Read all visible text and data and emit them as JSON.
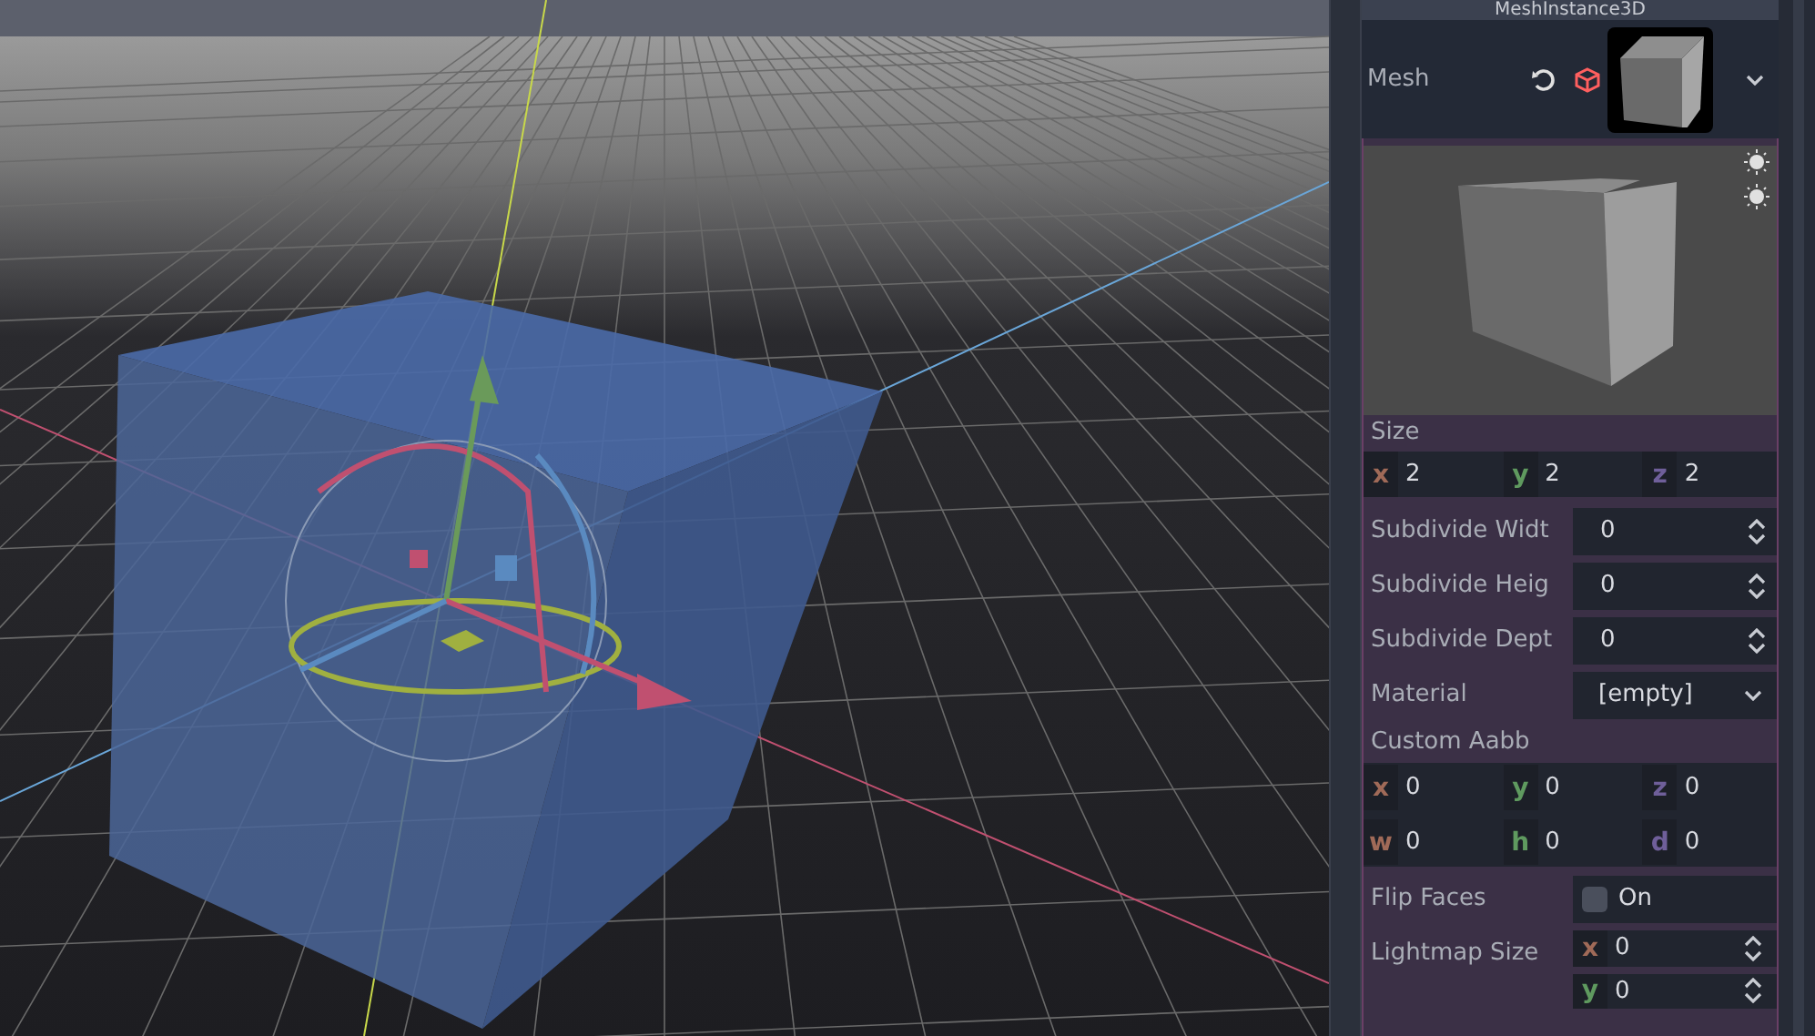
{
  "inspector": {
    "node_title": "MeshInstance3D",
    "mesh": {
      "label": "Mesh"
    },
    "size": {
      "label": "Size",
      "fields": [
        {
          "axis": "x",
          "value": "2",
          "color": "#a06a58"
        },
        {
          "axis": "y",
          "value": "2",
          "color": "#5f9a5f"
        },
        {
          "axis": "z",
          "value": "2",
          "color": "#6f5f9a"
        }
      ]
    },
    "properties": [
      {
        "kind": "spin",
        "label": "Subdivide Widt",
        "value": "0"
      },
      {
        "kind": "spin",
        "label": "Subdivide Heig",
        "value": "0"
      },
      {
        "kind": "spin",
        "label": "Subdivide Dept",
        "value": "0"
      },
      {
        "kind": "dropdown",
        "label": "Material",
        "value": "[empty]"
      }
    ],
    "custom_aabb": {
      "label": "Custom Aabb",
      "fields": [
        {
          "axis": "x",
          "value": "0",
          "color": "#a06a58"
        },
        {
          "axis": "y",
          "value": "0",
          "color": "#5f9a5f"
        },
        {
          "axis": "z",
          "value": "0",
          "color": "#6f5f9a"
        },
        {
          "axis": "w",
          "value": "0",
          "color": "#a06a58"
        },
        {
          "axis": "h",
          "value": "0",
          "color": "#5f9a5f"
        },
        {
          "axis": "d",
          "value": "0",
          "color": "#6f5f9a"
        }
      ]
    },
    "flip_faces": {
      "label": "Flip Faces",
      "text": "On",
      "checked": false
    },
    "lightmap": {
      "label": "Lightmap Size",
      "fields": [
        {
          "axis": "x",
          "value": "0",
          "color": "#a06a58"
        },
        {
          "axis": "y",
          "value": "0",
          "color": "#5f9a5f"
        }
      ]
    }
  }
}
